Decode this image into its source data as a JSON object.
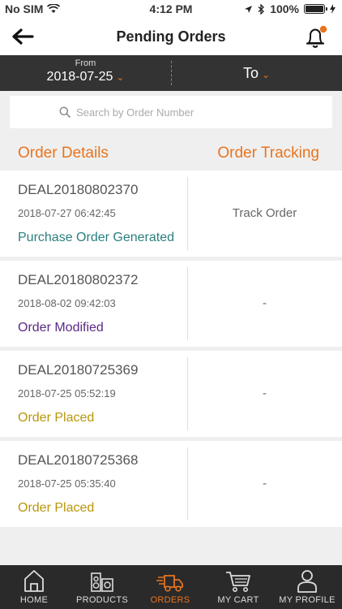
{
  "status_bar": {
    "carrier": "No SIM",
    "time": "4:12 PM",
    "battery": "100%"
  },
  "nav": {
    "title": "Pending Orders"
  },
  "date_filter": {
    "from_label": "From",
    "from_value": "2018-07-25",
    "to_label": "To"
  },
  "search": {
    "placeholder": "Search by Order Number"
  },
  "columns": {
    "details": "Order Details",
    "tracking": "Order Tracking"
  },
  "orders": [
    {
      "id": "DEAL20180802370",
      "datetime": "2018-07-27 06:42:45",
      "status": "Purchase Order Generated",
      "status_color": "#2a7f7f",
      "tracking": "Track Order"
    },
    {
      "id": "DEAL20180802372",
      "datetime": "2018-08-02 09:42:03",
      "status": "Order Modified",
      "status_color": "#5b2a86",
      "tracking": "-"
    },
    {
      "id": "DEAL20180725369",
      "datetime": "2018-07-25 05:52:19",
      "status": "Order Placed",
      "status_color": "#b8960c",
      "tracking": "-"
    },
    {
      "id": "DEAL20180725368",
      "datetime": "2018-07-25 05:35:40",
      "status": "Order Placed",
      "status_color": "#b8960c",
      "tracking": "-"
    }
  ],
  "tabs": [
    {
      "label": "HOME",
      "icon": "home-icon"
    },
    {
      "label": "PRODUCTS",
      "icon": "products-icon"
    },
    {
      "label": "ORDERS",
      "icon": "truck-icon",
      "active": true
    },
    {
      "label": "MY CART",
      "icon": "cart-icon"
    },
    {
      "label": "MY PROFILE",
      "icon": "profile-icon"
    }
  ],
  "colors": {
    "accent": "#e8741f",
    "dark_bar": "#333333",
    "tab_bar": "#2a2a2a"
  }
}
